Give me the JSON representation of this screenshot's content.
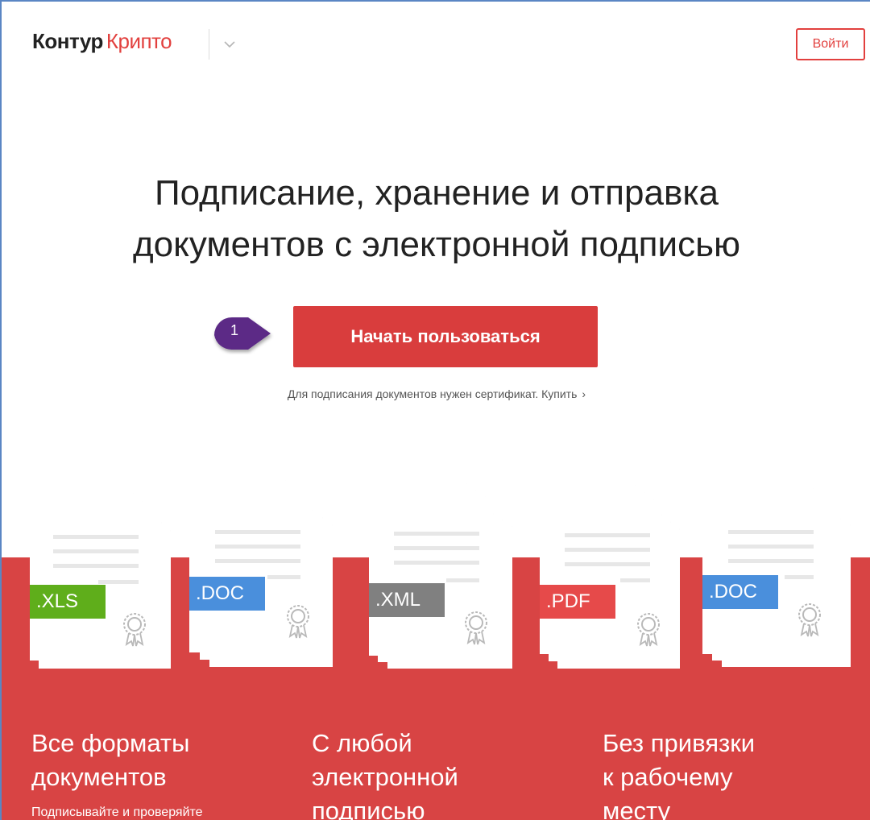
{
  "header": {
    "logo_part1": "Контур",
    "logo_part2": "Крипто",
    "login_label": "Войти"
  },
  "hero": {
    "title_line1": "Подписание, хранение и отправка",
    "title_line2": "документов с электронной подписью",
    "cta_label": "Начать пользоваться",
    "step_marker": "1",
    "note": "Для подписания документов нужен сертификат. Купить",
    "note_arrow": "›"
  },
  "formats": [
    ".XLS",
    ".DOC",
    ".XML",
    ".PDF",
    ".DOC"
  ],
  "format_colors": [
    "#5fae1b",
    "#4a8fdc",
    "#808080",
    "#e64a4a",
    "#4a8fdc"
  ],
  "features": {
    "col1": [
      "Все форматы",
      "документов"
    ],
    "col1_sub": "Подписывайте  и проверяйте",
    "col2": [
      "С любой",
      "электронной",
      "подписью"
    ],
    "col3": [
      "Без привязки",
      "к рабочему",
      "месту"
    ]
  },
  "colors": {
    "brand": "#e2403e",
    "band": "#d84444",
    "marker": "#5b2a86"
  }
}
